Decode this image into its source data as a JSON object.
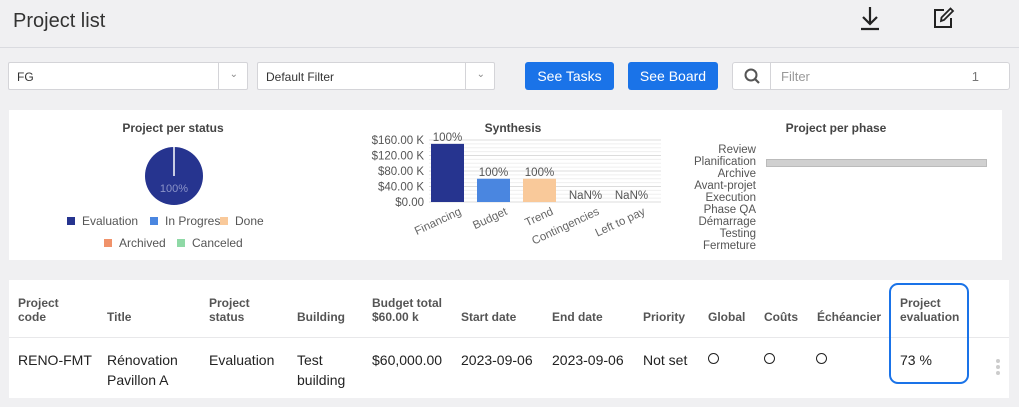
{
  "header": {
    "title": "Project list",
    "icons": [
      "download-icon",
      "edit-icon"
    ]
  },
  "toolbar": {
    "project_select": "FG",
    "filter_select": "Default Filter",
    "see_tasks": "See Tasks",
    "see_board": "See Board",
    "search_placeholder": "Filter",
    "result_count": "1"
  },
  "charts": {
    "status": {
      "title": "Project per status",
      "legend": [
        {
          "label": "Evaluation",
          "color": "#26348f"
        },
        {
          "label": "In Progress",
          "color": "#4a86e0"
        },
        {
          "label": "Done",
          "color": "#f9c99a"
        },
        {
          "label": "Archived",
          "color": "#f0926a"
        },
        {
          "label": "Canceled",
          "color": "#8fd9a6"
        }
      ]
    },
    "synthesis": {
      "title": "Synthesis"
    },
    "phase": {
      "title": "Project per phase",
      "labels": [
        "Review",
        "Planification",
        "Archive",
        "Avant-projet",
        "Execution",
        "Phase QA",
        "Démarrage",
        "Testing",
        "Fermeture"
      ]
    }
  },
  "chart_data": [
    {
      "type": "pie",
      "title": "Project per status",
      "categories": [
        "Evaluation",
        "In Progress",
        "Done",
        "Archived",
        "Canceled"
      ],
      "values": [
        100,
        0,
        0,
        0,
        0
      ],
      "label": "100%"
    },
    {
      "type": "bar",
      "title": "Synthesis",
      "categories": [
        "Financing",
        "Budget",
        "Trend",
        "Contingencies",
        "Left to pay"
      ],
      "values": [
        150000,
        60000,
        60000,
        0,
        0
      ],
      "data_labels": [
        "100%",
        "100%",
        "100%",
        "NaN%",
        "NaN%"
      ],
      "colors": [
        "#26348f",
        "#4a86e0",
        "#f9c99a",
        "#f0926a",
        "#8fd9a6"
      ],
      "yticks": [
        "$0.00",
        "$40.00 K",
        "$80.00 K",
        "$120.00 K",
        "$160.00 K"
      ],
      "ylim": [
        0,
        160000
      ],
      "grid": true
    },
    {
      "type": "bar",
      "title": "Project per phase",
      "categories": [
        "Review",
        "Planification",
        "Archive",
        "Avant-projet",
        "Execution",
        "Phase QA",
        "Démarrage",
        "Testing",
        "Fermeture"
      ],
      "values": [
        0,
        1,
        0,
        0,
        0,
        0,
        0,
        0,
        0
      ],
      "orientation": "horizontal"
    }
  ],
  "table": {
    "headers": {
      "code": [
        "Project",
        "code"
      ],
      "title": "Title",
      "status": [
        "Project",
        "status"
      ],
      "building": "Building",
      "budget": [
        "Budget total",
        "$60.00 k"
      ],
      "start": "Start date",
      "end": "End date",
      "priority": "Priority",
      "global": "Global",
      "couts": "Coûts",
      "echeancier": "Échéancier",
      "evaluation": [
        "Project",
        "evaluation"
      ]
    },
    "row": {
      "code": "RENO-FMT",
      "title": [
        "Rénovation",
        "Pavillon A"
      ],
      "status": "Evaluation",
      "building": [
        "Test",
        "building"
      ],
      "budget": "$60,000.00",
      "start": "2023-09-06",
      "end": "2023-09-06",
      "priority": "Not set",
      "evaluation": "73 %"
    }
  }
}
